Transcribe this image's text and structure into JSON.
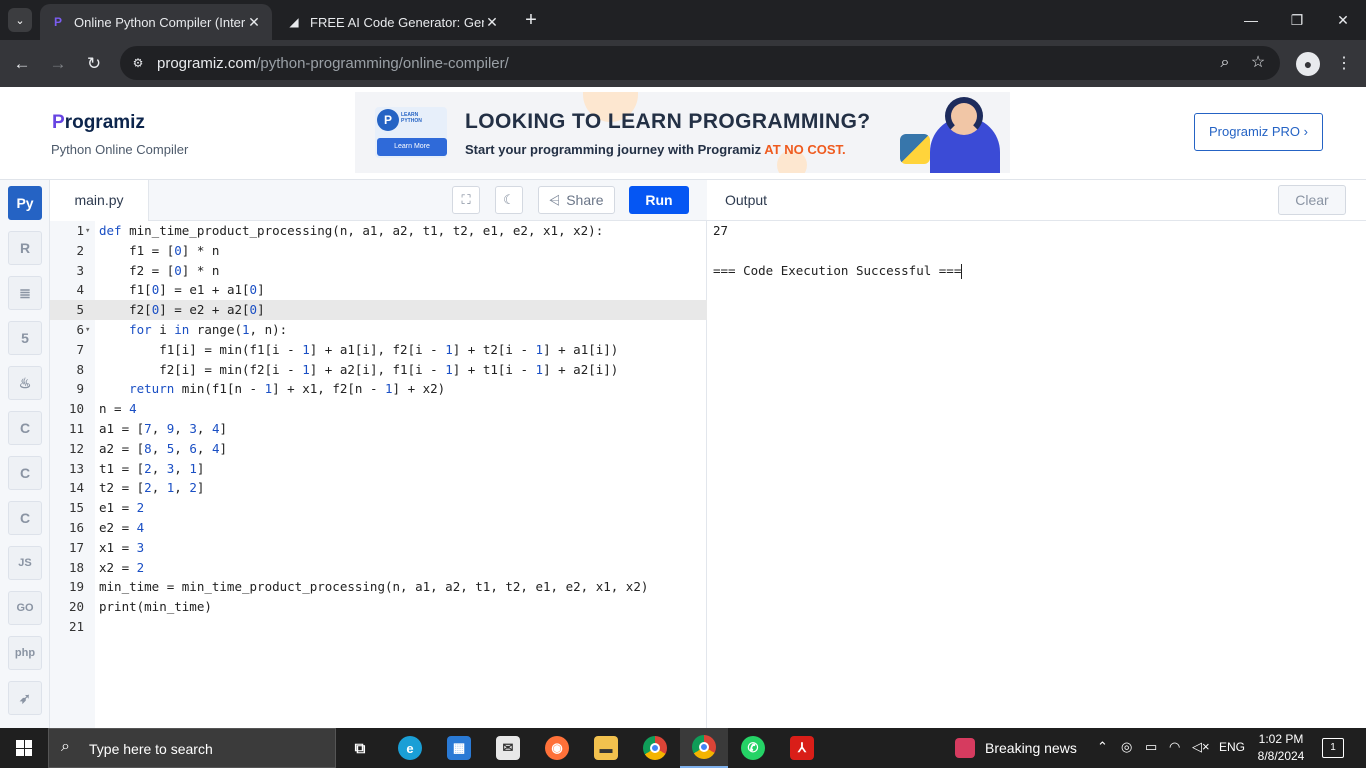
{
  "browser": {
    "tabs": [
      {
        "title": "Online Python Compiler (Interp",
        "active": true
      },
      {
        "title": "FREE AI Code Generator: Gener",
        "active": false
      }
    ],
    "url_host": "programiz.com",
    "url_path": "/python-programming/online-compiler/"
  },
  "site": {
    "logo_p": "P",
    "logo_rest": "rogramiz",
    "subtitle": "Python Online Compiler",
    "banner": {
      "badge_text": "LEARN PYTHON",
      "badge_button": "Learn More",
      "headline": "LOOKING TO LEARN PROGRAMMING?",
      "subline": "Start your programming journey with Programiz ",
      "subline_highlight": "AT NO COST."
    },
    "pro_button": "Programiz PRO ›"
  },
  "sidebar": {
    "languages": [
      {
        "icon": "python-icon",
        "glyph": "Py",
        "active": true
      },
      {
        "icon": "r-icon",
        "glyph": "R"
      },
      {
        "icon": "database-icon",
        "glyph": "≣"
      },
      {
        "icon": "html5-icon",
        "glyph": "5"
      },
      {
        "icon": "java-icon",
        "glyph": "♨"
      },
      {
        "icon": "c-icon",
        "glyph": "C"
      },
      {
        "icon": "cpp-icon",
        "glyph": "C"
      },
      {
        "icon": "csharp-icon",
        "glyph": "C"
      },
      {
        "icon": "js-icon",
        "glyph": "JS"
      },
      {
        "icon": "go-icon",
        "glyph": "GO"
      },
      {
        "icon": "php-icon",
        "glyph": "php"
      },
      {
        "icon": "swift-icon",
        "glyph": "➶"
      }
    ]
  },
  "editor": {
    "file_tab": "main.py",
    "share_label": "Share",
    "run_label": "Run",
    "highlighted_line": 5,
    "lines": [
      "def min_time_product_processing(n, a1, a2, t1, t2, e1, e2, x1, x2):",
      "    f1 = [0] * n",
      "    f2 = [0] * n",
      "    f1[0] = e1 + a1[0]",
      "    f2[0] = e2 + a2[0]",
      "    for i in range(1, n):",
      "        f1[i] = min(f1[i - 1] + a1[i], f2[i - 1] + t2[i - 1] + a1[i])",
      "        f2[i] = min(f2[i - 1] + a2[i], f1[i - 1] + t1[i - 1] + a2[i])",
      "    return min(f1[n - 1] + x1, f2[n - 1] + x2)",
      "n = 4",
      "a1 = [7, 9, 3, 4]",
      "a2 = [8, 5, 6, 4]",
      "t1 = [2, 3, 1]",
      "t2 = [2, 1, 2]",
      "e1 = 2",
      "e2 = 4",
      "x1 = 3",
      "x2 = 2",
      "min_time = min_time_product_processing(n, a1, a2, t1, t2, e1, e2, x1, x2)",
      "print(min_time)",
      ""
    ],
    "fold_lines": [
      1,
      6
    ]
  },
  "output": {
    "title": "Output",
    "clear_label": "Clear",
    "lines": [
      "27",
      "",
      "=== Code Execution Successful ==="
    ]
  },
  "taskbar": {
    "search_placeholder": "Type here to search",
    "news_label": "Breaking news",
    "language": "ENG",
    "time": "1:02 PM",
    "date": "8/8/2024",
    "notification_count": "1"
  },
  "colors": {
    "run_button": "#0556f3",
    "accent_blue": "#2563c4",
    "banner_highlight": "#ef5b1f"
  }
}
